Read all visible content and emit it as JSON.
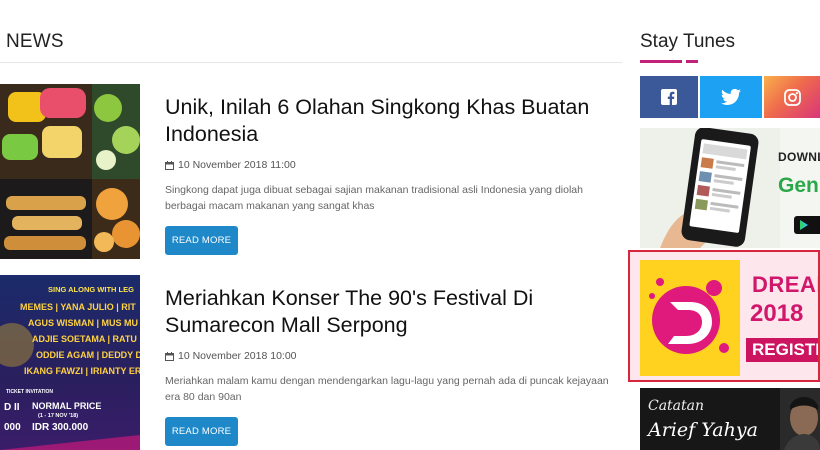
{
  "main": {
    "section_title": "NEWS",
    "articles": [
      {
        "title": "Unik, Inilah 6 Olahan Singkong Khas Buatan Indonesia",
        "date": "10 November 2018 11:00",
        "excerpt": "Singkong dapat juga dibuat sebagai sajian makanan tradisional asli Indonesia yang diolah berbagai macam makanan yang sangat khas",
        "read_more": "READ MORE"
      },
      {
        "title": "Meriahkan Konser The 90's Festival Di Sumarecon Mall Serpong",
        "date": "10 November 2018 10:00",
        "excerpt": "Meriahkan malam kamu dengan mendengarkan lagu-lagu yang pernah ada di puncak kejayaan era 80 dan 90an",
        "read_more": "READ MORE"
      }
    ],
    "poster": {
      "header": "SING ALONG WITH LEG",
      "rows": [
        "MEMES | YANA JULIO | RIT",
        "AGUS WISMAN | MUS MU",
        "ADJIE SOETAMA | RATU",
        "ODDIE AGAM | DEDDY DI",
        "IKANG FAWZI | IRIANTY ERN"
      ],
      "ticket_label": "TICKET INVITATION",
      "normal_price_label": "NORMAL PRICE",
      "normal_price_dates": "(1 - 17 NOV '18)",
      "normal_price_value": "IDR 300.000",
      "left_label": "D II",
      "left_value": "000"
    }
  },
  "sidebar": {
    "title": "Stay Tunes",
    "social": [
      {
        "name": "facebook",
        "icon": "facebook-icon",
        "color": "#3b5998"
      },
      {
        "name": "twitter",
        "icon": "twitter-icon",
        "color": "#1da1f2"
      },
      {
        "name": "instagram",
        "icon": "instagram-icon",
        "color": "#d9357a"
      }
    ],
    "app_banner": {
      "download": "DOWNLO",
      "brand": "Gen"
    },
    "dream_banner": {
      "line1": "DREAM A",
      "line2": "2018",
      "cta": "REGISTER"
    },
    "catatan_banner": {
      "line1": "Catatan",
      "line2": "Arief Yahya"
    }
  }
}
